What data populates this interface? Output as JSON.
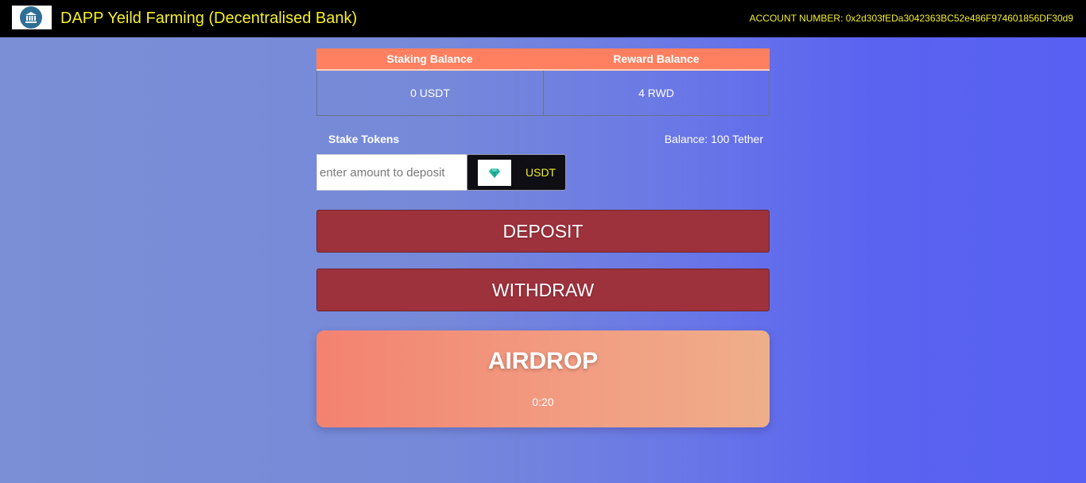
{
  "navbar": {
    "brand": "DAPP Yeild Farming (Decentralised Bank)",
    "account_label": "ACCOUNT NUMBER: 0x2d303fEDa3042363BC52e486F974601856DF30d9",
    "logo_icon": "bank-icon"
  },
  "balances": {
    "headers": [
      "Staking Balance",
      "Reward Balance"
    ],
    "values": [
      "0 USDT",
      "4 RWD"
    ]
  },
  "stake": {
    "label": "Stake Tokens",
    "balance": "Balance: 100 Tether",
    "input_placeholder": "enter amount to deposit",
    "input_value": "",
    "token_icon": "diamond-icon",
    "token_label": "USDT"
  },
  "actions": {
    "deposit_label": "DEPOSIT",
    "withdraw_label": "WITHDRAW"
  },
  "airdrop": {
    "title": "AIRDROP",
    "timer": "0:20"
  },
  "colors": {
    "accent_yellow": "#f5f02a",
    "header_orange": "#ff8060",
    "button_red": "#9d313c"
  }
}
